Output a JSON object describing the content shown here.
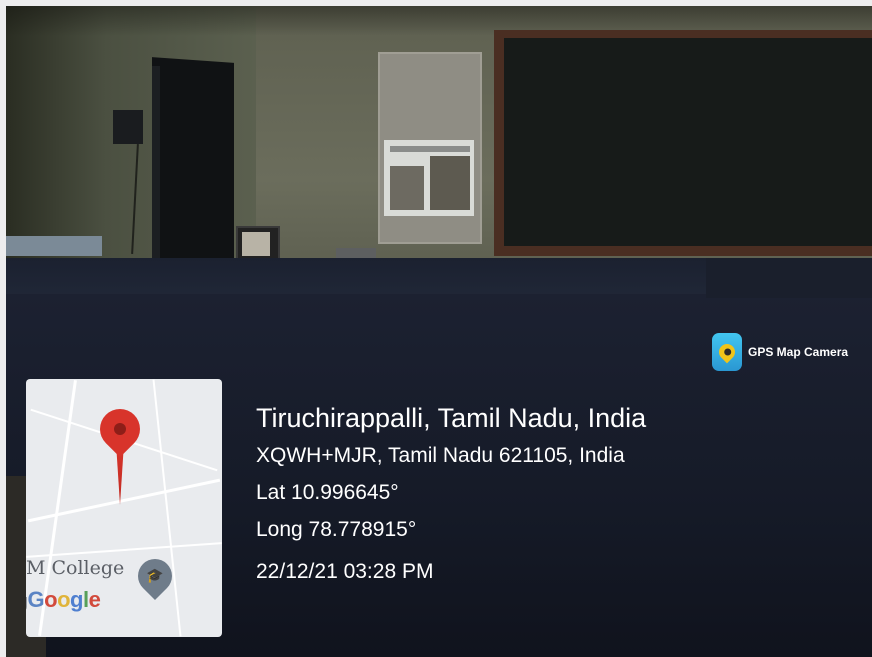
{
  "overlay": {
    "app_name": "GPS Map Camera",
    "app_icon": "gps-map-camera-icon",
    "map": {
      "place_label": "M College",
      "logo_text": "Google",
      "pin_icon": "map-pin-icon",
      "place_marker_icon": "graduation-cap-icon"
    },
    "location": {
      "city": "Tiruchirappalli, Tamil Nadu, India",
      "address": "XQWH+MJR, Tamil Nadu 621105, India",
      "latitude": "Lat 10.996645°",
      "longitude": "Long 78.778915°",
      "datetime": "22/12/21 03:28 PM"
    }
  },
  "colors": {
    "overlay_text": "#ffffff",
    "pin": "#d8342b",
    "map_bg": "#e9ebee",
    "app_icon": "#2a97d2"
  }
}
